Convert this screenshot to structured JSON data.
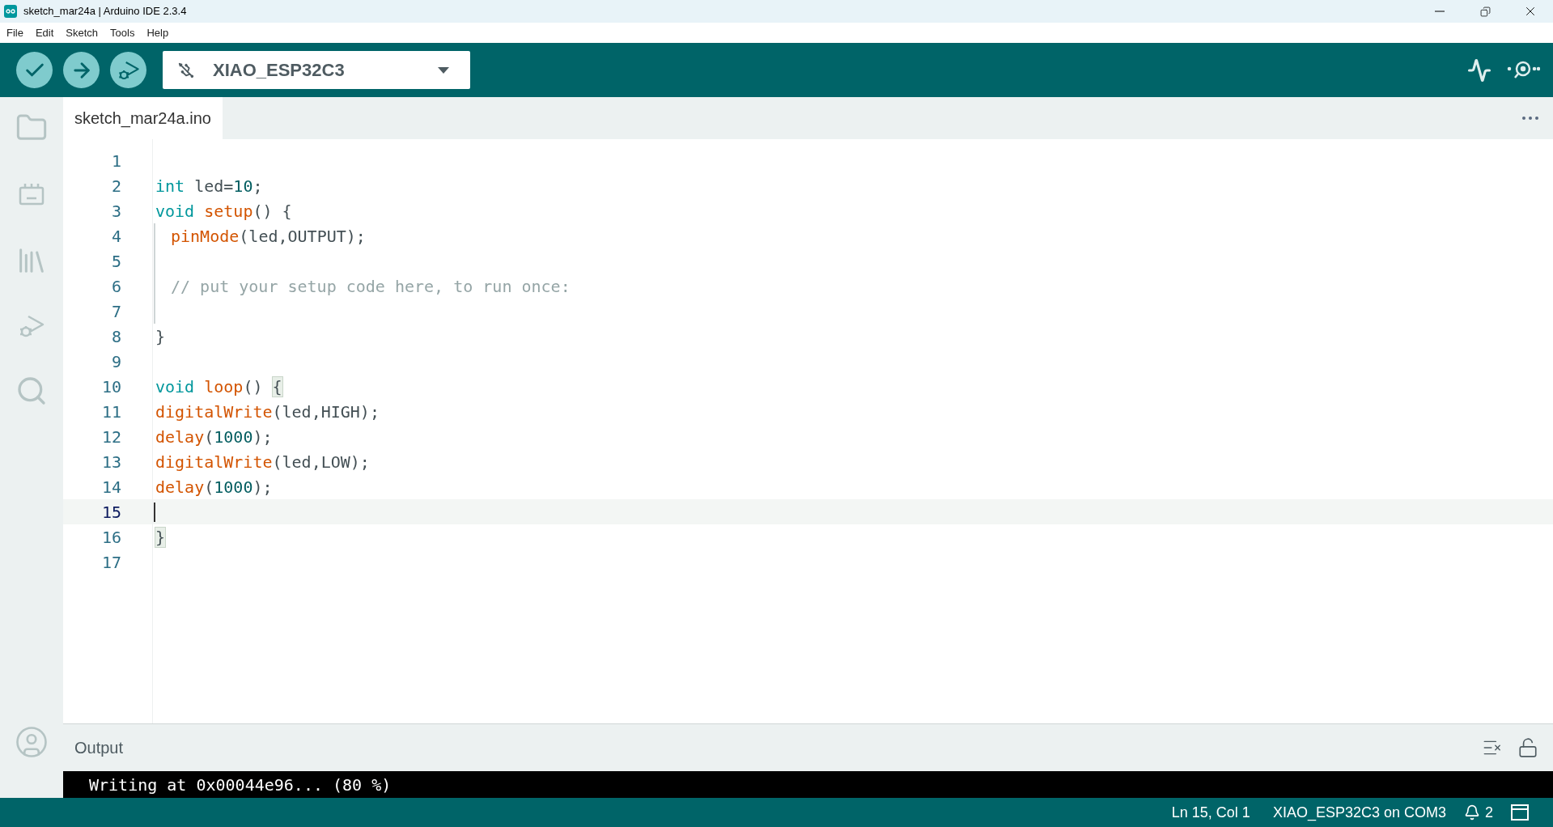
{
  "window": {
    "title": "sketch_mar24a | Arduino IDE 2.3.4"
  },
  "menu": [
    "File",
    "Edit",
    "Sketch",
    "Tools",
    "Help"
  ],
  "board_selector": {
    "value": "XIAO_ESP32C3"
  },
  "tabs": [
    {
      "label": "sketch_mar24a.ino",
      "selected": true
    }
  ],
  "editor": {
    "lines": [
      {
        "number": "1",
        "selected": false,
        "indented": false
      },
      {
        "number": "2",
        "selected": false,
        "indented": false,
        "tokens": [
          {
            "kind": "keyword",
            "text": "int"
          },
          {
            "kind": "plain",
            "text": " led="
          },
          {
            "kind": "number",
            "text": "10"
          },
          {
            "kind": "plain",
            "text": ";"
          }
        ]
      },
      {
        "number": "3",
        "selected": false,
        "indented": false,
        "tokens": [
          {
            "kind": "keyword",
            "text": "void "
          },
          {
            "kind": "function",
            "text": "setup"
          },
          {
            "kind": "plain",
            "text": "() {"
          }
        ]
      },
      {
        "number": "4",
        "selected": false,
        "indented": true,
        "tokens": [
          {
            "kind": "function",
            "text": "pinMode"
          },
          {
            "kind": "plain",
            "text": "(led,OUTPUT);"
          }
        ]
      },
      {
        "number": "5",
        "selected": false,
        "indented": true
      },
      {
        "number": "6",
        "selected": false,
        "indented": true,
        "tokens": [
          {
            "kind": "comment",
            "text": "// put your setup code here, to run once:"
          }
        ]
      },
      {
        "number": "7",
        "selected": false,
        "indented": true
      },
      {
        "number": "8",
        "selected": false,
        "indented": false,
        "tokens": [
          {
            "kind": "plain",
            "text": "}"
          }
        ]
      },
      {
        "number": "9",
        "selected": false,
        "indented": false
      },
      {
        "number": "10",
        "selected": false,
        "indented": false,
        "tokens": [
          {
            "kind": "keyword",
            "text": "void "
          },
          {
            "kind": "function",
            "text": "loop"
          },
          {
            "kind": "plain",
            "text": "() "
          },
          {
            "kind": "bracket_match",
            "text": "{"
          }
        ]
      },
      {
        "number": "11",
        "selected": false,
        "indented": false,
        "tokens": [
          {
            "kind": "function",
            "text": "digitalWrite"
          },
          {
            "kind": "plain",
            "text": "(led,HIGH);"
          }
        ]
      },
      {
        "number": "12",
        "selected": false,
        "indented": false,
        "tokens": [
          {
            "kind": "function",
            "text": "delay"
          },
          {
            "kind": "plain",
            "text": "("
          },
          {
            "kind": "number",
            "text": "1000"
          },
          {
            "kind": "plain",
            "text": ");"
          }
        ]
      },
      {
        "number": "13",
        "selected": false,
        "indented": false,
        "tokens": [
          {
            "kind": "function",
            "text": "digitalWrite"
          },
          {
            "kind": "plain",
            "text": "(led,LOW);"
          }
        ]
      },
      {
        "number": "14",
        "selected": false,
        "indented": false,
        "tokens": [
          {
            "kind": "function",
            "text": "delay"
          },
          {
            "kind": "plain",
            "text": "("
          },
          {
            "kind": "number",
            "text": "1000"
          },
          {
            "kind": "plain",
            "text": ");"
          }
        ]
      },
      {
        "number": "15",
        "selected": true,
        "indented": false
      },
      {
        "number": "16",
        "selected": false,
        "indented": false,
        "tokens": [
          {
            "kind": "bracket_match",
            "text": "}"
          }
        ]
      },
      {
        "number": "17",
        "selected": false,
        "indented": false
      }
    ]
  },
  "output": {
    "title": "Output",
    "text": "Writing at 0x00044e96... (80 %)"
  },
  "status_bar": {
    "position": "Ln 15, Col 1",
    "board": "XIAO_ESP32C3 on COM3",
    "notifications": "2"
  }
}
